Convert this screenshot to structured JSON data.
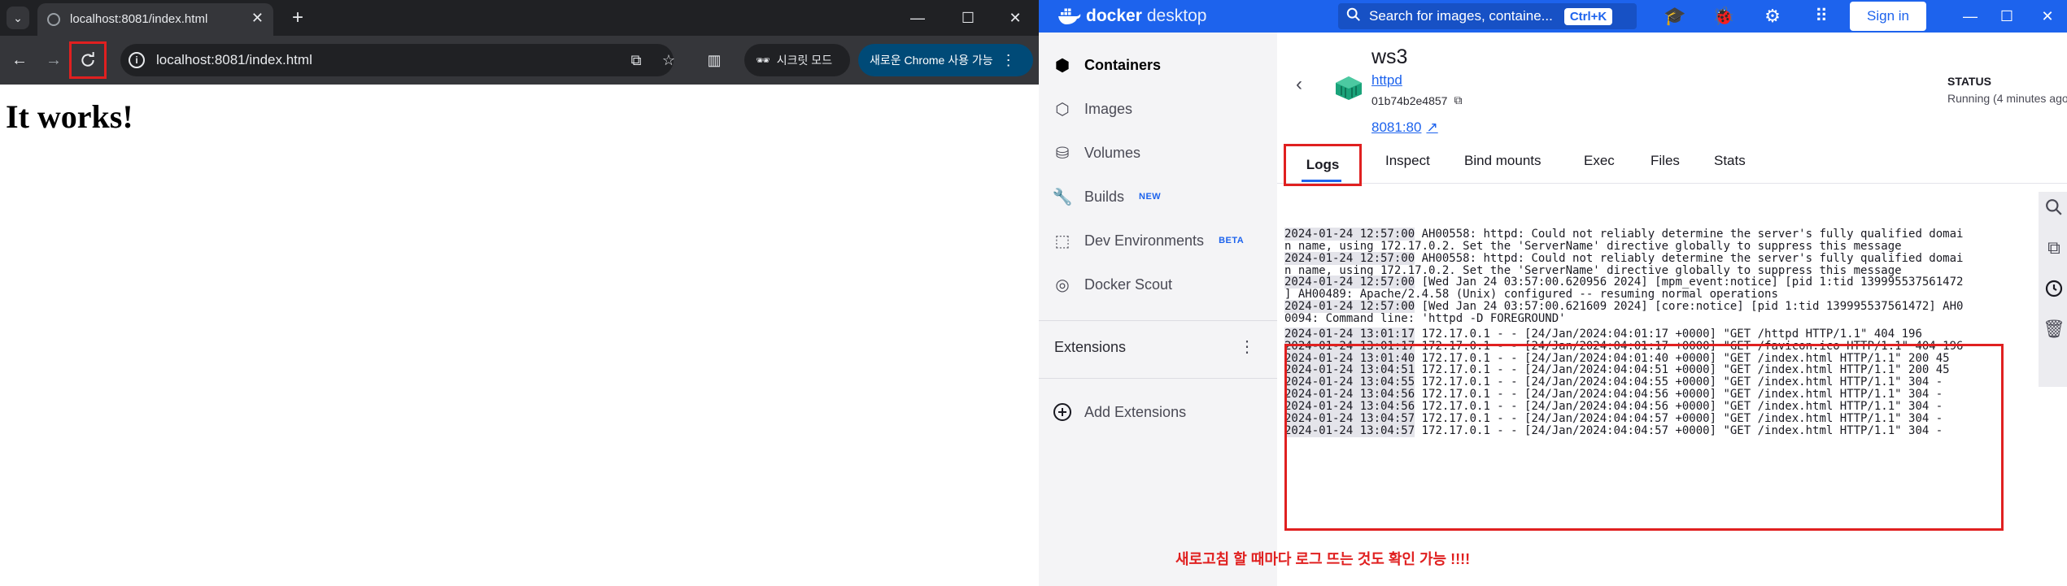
{
  "chrome": {
    "tab_title": "localhost:8081/index.html",
    "url": "localhost:8081/index.html",
    "incognito_label": "시크릿 모드",
    "update_label": "새로운 Chrome 사용 가능",
    "page_heading": "It works!"
  },
  "docker": {
    "brand_bold": "docker",
    "brand_light": "desktop",
    "search_placeholder": "Search for images, containe...",
    "search_shortcut": "Ctrl+K",
    "signin_label": "Sign in",
    "sidebar": {
      "items": [
        {
          "label": "Containers",
          "icon": "containers-icon"
        },
        {
          "label": "Images",
          "icon": "images-icon"
        },
        {
          "label": "Volumes",
          "icon": "volumes-icon"
        },
        {
          "label": "Builds",
          "badge": "NEW",
          "icon": "builds-icon"
        },
        {
          "label": "Dev Environments",
          "badge": "BETA",
          "icon": "dev-environments-icon"
        },
        {
          "label": "Docker Scout",
          "icon": "docker-scout-icon"
        }
      ],
      "extensions_label": "Extensions",
      "add_extensions_label": "Add Extensions"
    },
    "container": {
      "name": "ws3",
      "image": "httpd",
      "id": "01b74b2e4857",
      "port": "8081:80",
      "status_label": "STATUS",
      "status_value": "Running (4 minutes ago)"
    },
    "tabs": [
      "Logs",
      "Inspect",
      "Bind mounts",
      "Exec",
      "Files",
      "Stats"
    ],
    "logs": [
      {
        "ts": "2024-01-24 12:57:00",
        "msg": " AH00558: httpd: Could not reliably determine the server's fully qualified domai"
      },
      {
        "ts": "",
        "msg": "n name, using 172.17.0.2. Set the 'ServerName' directive globally to suppress this message"
      },
      {
        "ts": "2024-01-24 12:57:00",
        "msg": " AH00558: httpd: Could not reliably determine the server's fully qualified domai"
      },
      {
        "ts": "",
        "msg": "n name, using 172.17.0.2. Set the 'ServerName' directive globally to suppress this message"
      },
      {
        "ts": "2024-01-24 12:57:00",
        "msg": " [Wed Jan 24 03:57:00.620956 2024] [mpm_event:notice] [pid 1:tid 139995537561472"
      },
      {
        "ts": "",
        "msg": "] AH00489: Apache/2.4.58 (Unix) configured -- resuming normal operations"
      },
      {
        "ts": "2024-01-24 12:57:00",
        "msg": " [Wed Jan 24 03:57:00.621609 2024] [core:notice] [pid 1:tid 139995537561472] AH0"
      },
      {
        "ts": "",
        "msg": "0094: Command line: 'httpd -D FOREGROUND'"
      },
      {
        "ts": "2024-01-24 13:01:17",
        "msg": " 172.17.0.1 - - [24/Jan/2024:04:01:17 +0000] \"GET /httpd HTTP/1.1\" 404 196"
      },
      {
        "ts": "2024-01-24 13:01:17",
        "msg": " 172.17.0.1 - - [24/Jan/2024:04:01:17 +0000] \"GET /favicon.ico HTTP/1.1\" 404 196"
      },
      {
        "ts": "2024-01-24 13:01:40",
        "msg": " 172.17.0.1 - - [24/Jan/2024:04:01:40 +0000] \"GET /index.html HTTP/1.1\" 200 45"
      },
      {
        "ts": "2024-01-24 13:04:51",
        "msg": " 172.17.0.1 - - [24/Jan/2024:04:04:51 +0000] \"GET /index.html HTTP/1.1\" 200 45"
      },
      {
        "ts": "2024-01-24 13:04:55",
        "msg": " 172.17.0.1 - - [24/Jan/2024:04:04:55 +0000] \"GET /index.html HTTP/1.1\" 304 -"
      },
      {
        "ts": "2024-01-24 13:04:56",
        "msg": " 172.17.0.1 - - [24/Jan/2024:04:04:56 +0000] \"GET /index.html HTTP/1.1\" 304 -"
      },
      {
        "ts": "2024-01-24 13:04:56",
        "msg": " 172.17.0.1 - - [24/Jan/2024:04:04:56 +0000] \"GET /index.html HTTP/1.1\" 304 -"
      },
      {
        "ts": "2024-01-24 13:04:57",
        "msg": " 172.17.0.1 - - [24/Jan/2024:04:04:57 +0000] \"GET /index.html HTTP/1.1\" 304 -"
      },
      {
        "ts": "2024-01-24 13:04:57",
        "msg": " 172.17.0.1 - - [24/Jan/2024:04:04:57 +0000] \"GET /index.html HTTP/1.1\" 304 -"
      }
    ]
  },
  "annotation": "새로고침 할 때마다 로그 뜨는 것도 확인 가능 !!!!",
  "colors": {
    "docker_blue": "#1d63ed",
    "highlight_red": "#e02020",
    "stop_danger": "#e0242b",
    "chrome_dark": "#202124"
  }
}
